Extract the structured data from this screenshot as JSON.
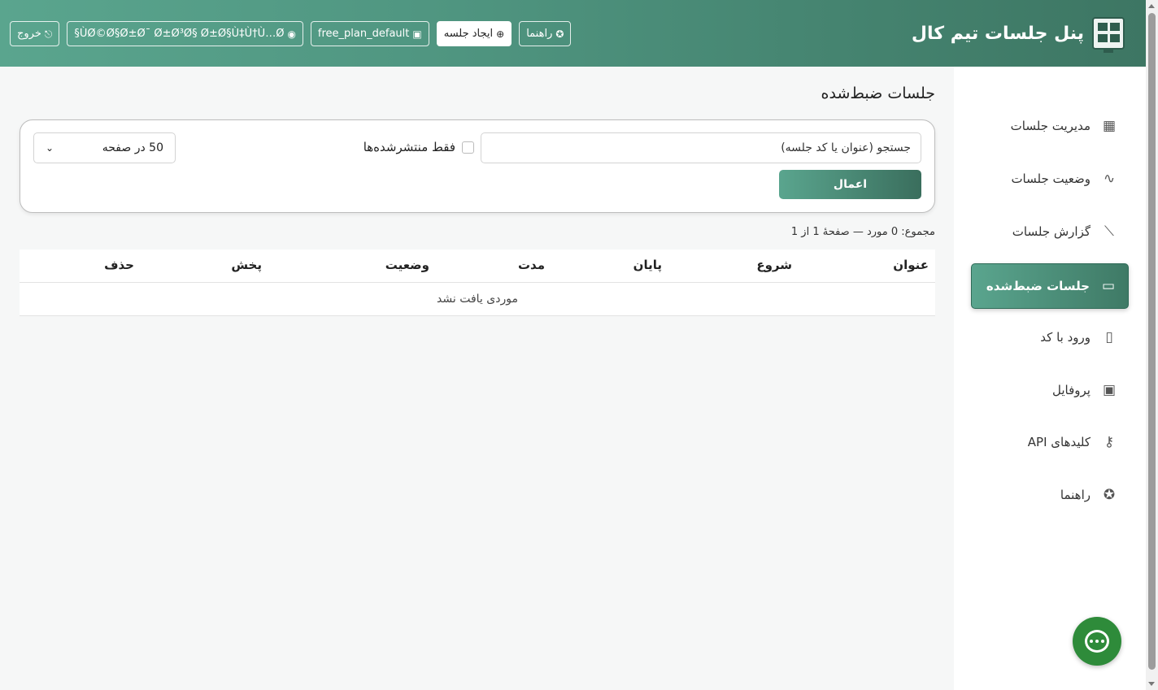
{
  "header": {
    "title": "پنل جلسات تیم کال",
    "buttons": {
      "help": "راهنما",
      "create": "ایجاد جلسه",
      "plan": "free_plan_default",
      "user": "§ÙØ©Ø§Ø±Ø¯ Ø±Ø³Ø§ Ø±Ø§Ù‡Ù†Ù…Ø",
      "logout": "خروج"
    }
  },
  "sidebar": {
    "items": [
      {
        "label": "مدیریت جلسات",
        "icon": "grid-icon"
      },
      {
        "label": "وضعیت جلسات",
        "icon": "activity-icon"
      },
      {
        "label": "گزارش جلسات",
        "icon": "chart-line-icon"
      },
      {
        "label": "جلسات ضبط‌شده",
        "icon": "video-camera-icon",
        "active": true
      },
      {
        "label": "ورود با کد",
        "icon": "door-icon"
      },
      {
        "label": "پروفایل",
        "icon": "profile-icon"
      },
      {
        "label": "کلیدهای API",
        "icon": "key-icon"
      },
      {
        "label": "راهنما",
        "icon": "lifebuoy-icon"
      }
    ]
  },
  "main": {
    "title": "جلسات ضبط‌شده",
    "filters": {
      "search_placeholder": "جستجو (عنوان یا کد جلسه)",
      "published_only": "فقط منتشرشده‌ها",
      "per_page": "50 در صفحه",
      "apply": "اعمال"
    },
    "summary": "مجموع: 0 مورد — صفحهٔ 1 از 1",
    "table": {
      "columns": [
        "عنوان",
        "شروع",
        "پایان",
        "مدت",
        "وضعیت",
        "پخش",
        "حذف"
      ],
      "empty": "موردی یافت نشد"
    }
  },
  "colors": {
    "brand": "#4f9580",
    "chat": "#2e8b3a"
  }
}
